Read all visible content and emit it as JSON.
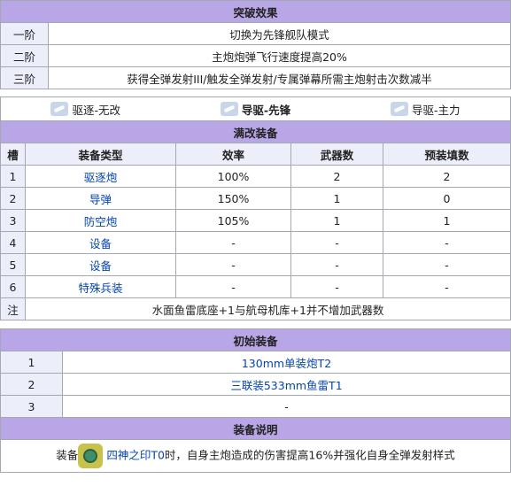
{
  "breakthrough": {
    "title": "突破效果",
    "rows": [
      {
        "stage": "一阶",
        "text": "切换为先锋舰队模式"
      },
      {
        "stage": "二阶",
        "text": "主炮炮弹飞行速度提高20%"
      },
      {
        "stage": "三阶",
        "text": "获得全弹发射III/触发全弹发射/专属弹幕所需主炮射击次数减半"
      }
    ]
  },
  "ship_types": [
    {
      "label": "驱逐-无改",
      "bold": false,
      "icon": "destroyer-icon"
    },
    {
      "label": "导驱-先锋",
      "bold": true,
      "icon": "guided-destroyer-icon"
    },
    {
      "label": "导驱-主力",
      "bold": false,
      "icon": "guided-destroyer-icon"
    }
  ],
  "max_equipment": {
    "title": "满改装备",
    "headers": [
      "槽",
      "装备类型",
      "效率",
      "武器数",
      "预装填数"
    ],
    "rows": [
      {
        "slot": "1",
        "type": "驱逐炮",
        "eff": "100%",
        "weapons": "2",
        "preload": "2"
      },
      {
        "slot": "2",
        "type": "导弹",
        "eff": "150%",
        "weapons": "1",
        "preload": "0"
      },
      {
        "slot": "3",
        "type": "防空炮",
        "eff": "105%",
        "weapons": "1",
        "preload": "1"
      },
      {
        "slot": "4",
        "type": "设备",
        "eff": "-",
        "weapons": "-",
        "preload": "-"
      },
      {
        "slot": "5",
        "type": "设备",
        "eff": "-",
        "weapons": "-",
        "preload": "-"
      },
      {
        "slot": "6",
        "type": "特殊兵装",
        "eff": "-",
        "weapons": "-",
        "preload": "-"
      }
    ],
    "note_label": "注",
    "note": "水面鱼雷底座+1与航母机库+1并不增加武器数"
  },
  "initial_equipment": {
    "title": "初始装备",
    "rows": [
      {
        "slot": "1",
        "name": "130mm单装炮T2"
      },
      {
        "slot": "2",
        "name": "三联装533mm鱼雷T1"
      },
      {
        "slot": "3",
        "name": "-"
      }
    ]
  },
  "equipment_note": {
    "title": "装备说明",
    "prefix": "装备",
    "item": "四神之印T0",
    "suffix": "时，自身主炮造成的伤害提高16%并强化自身全弹发射样式",
    "icon": "four-gods-seal-icon"
  }
}
